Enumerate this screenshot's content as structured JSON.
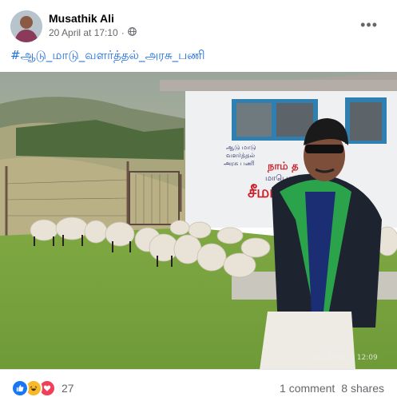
{
  "post": {
    "author": "Musathik Ali",
    "timestamp": "20 April at 17:10",
    "separator": "·",
    "privacy_icon": "globe-icon",
    "more_icon": "•••",
    "hashtag": "#ஆடு_மாடு_வளர்த்தல்_அரசு_பணி"
  },
  "photo": {
    "watermark": "2021/04/19 12:09",
    "wall_text": {
      "line1": "ஆடு மாடு",
      "line2": "வளர்த்தல்",
      "line3": "அரசு பணி",
      "banner": "நாம் த",
      "sub": "மாபெரும் போர",
      "big": "சீமா"
    }
  },
  "footer": {
    "reaction_count": "27",
    "comments": "1 comment",
    "shares": "8 shares"
  },
  "colors": {
    "link": "#216fdb",
    "like": "#1877f2",
    "haha": "#f7b928",
    "love": "#f33e58"
  }
}
